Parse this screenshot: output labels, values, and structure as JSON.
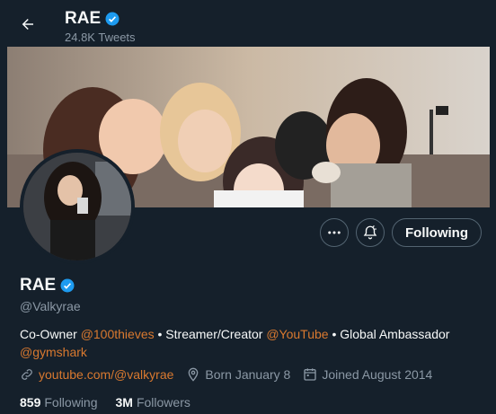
{
  "header": {
    "name": "RAE",
    "tweet_count": "24.8K Tweets"
  },
  "profile": {
    "name": "RAE",
    "handle": "@Valkyrae",
    "bio": {
      "p1": "Co-Owner ",
      "link1": "@100thieves",
      "p2": " • Streamer/Creator ",
      "link2": "@YouTube",
      "p3": " • Global Ambassador ",
      "link3": "@gymshark"
    },
    "website": "youtube.com/@valkyrae",
    "birthday": "Born January 8",
    "joined": "Joined August 2014",
    "following_count": "859",
    "following_label": "Following",
    "followers_count": "3M",
    "followers_label": "Followers"
  },
  "actions": {
    "following_label": "Following"
  },
  "colors": {
    "background": "#15202b",
    "link": "#d9792f",
    "verified": "#1d9bf0",
    "secondary_text": "#8b98a5"
  },
  "icons": [
    "back-arrow-icon",
    "verified-badge-icon",
    "more-icon",
    "notification-bell-icon",
    "link-icon",
    "location-pin-icon",
    "calendar-icon"
  ]
}
